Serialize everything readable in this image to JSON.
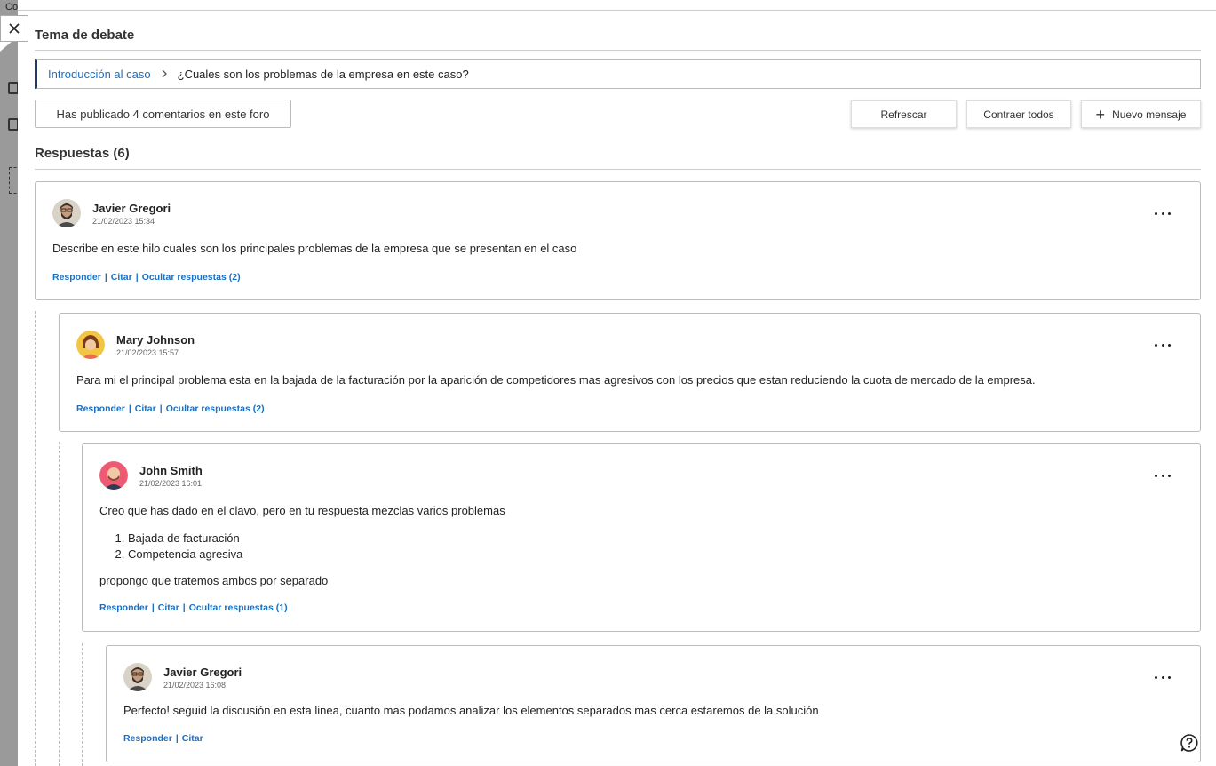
{
  "background": {
    "strip_text": "Co"
  },
  "close": {
    "icon": "close-icon"
  },
  "topic": {
    "heading": "Tema de debate",
    "breadcrumb_link": "Introducción al caso",
    "breadcrumb_current": "¿Cuales son los problemas de la empresa en este caso?"
  },
  "toolbar": {
    "stat": "Has publicado 4 comentarios en este foro",
    "refresh_label": "Refrescar",
    "collapse_label": "Contraer todos",
    "new_message_label": "Nuevo mensaje"
  },
  "responses_heading": "Respuestas (6)",
  "posts": [
    {
      "author": "Javier Gregori",
      "date": "21/02/2023 15:34",
      "text": "Describe en este hilo cuales son los principales problemas de la empresa que se presentan en el caso",
      "reply": "Responder",
      "quote": "Citar",
      "hide": "Ocultar respuestas (2)"
    },
    {
      "author": "Mary Johnson",
      "date": "21/02/2023 15:57",
      "text": "Para mi el principal problema esta en la bajada de la facturación por la aparición de competidores mas agresivos con los precios que estan reduciendo la cuota de mercado de la empresa.",
      "reply": "Responder",
      "quote": "Citar",
      "hide": "Ocultar respuestas (2)"
    },
    {
      "author": "John Smith",
      "date": "21/02/2023 16:01",
      "text": "Creo que has dado en el clavo, pero en tu respuesta mezclas varios problemas",
      "list": [
        "Bajada de facturación",
        "Competencia agresiva"
      ],
      "text2": "propongo que tratemos ambos por separado",
      "reply": "Responder",
      "quote": "Citar",
      "hide": "Ocultar respuestas (1)"
    },
    {
      "author": "Javier Gregori",
      "date": "21/02/2023 16:08",
      "text": "Perfecto! seguid la discusión en esta linea, cuanto mas podamos analizar los elementos separados mas cerca estaremos de la solución",
      "reply": "Responder",
      "quote": "Citar"
    }
  ]
}
